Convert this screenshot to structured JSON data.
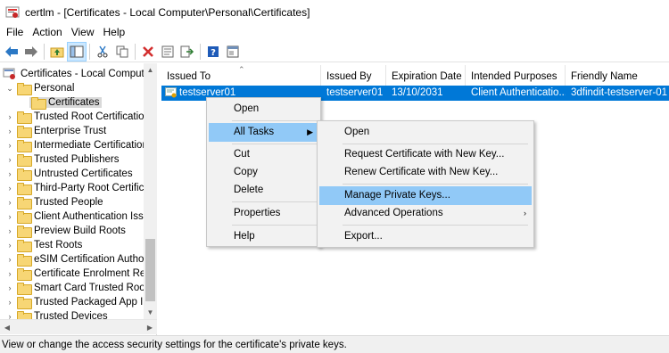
{
  "window": {
    "app_name": "certlm",
    "title": "certlm - [Certificates - Local Computer\\Personal\\Certificates]"
  },
  "menubar": [
    "File",
    "Action",
    "View",
    "Help"
  ],
  "toolbar": {
    "icons": [
      "back-arrow-icon",
      "forward-arrow-icon",
      "up-folder-icon",
      "show-hide-tree-icon",
      "cut-icon",
      "copy-icon",
      "delete-icon",
      "properties-icon",
      "export-icon",
      "help-icon",
      "console-icon"
    ]
  },
  "tree": {
    "root": "Certificates - Local Computer",
    "personal": "Personal",
    "certificates": "Certificates",
    "items": [
      "Trusted Root Certification",
      "Enterprise Trust",
      "Intermediate Certification",
      "Trusted Publishers",
      "Untrusted Certificates",
      "Third-Party Root Certificat",
      "Trusted People",
      "Client Authentication Issu",
      "Preview Build Roots",
      "Test Roots",
      "eSIM Certification Authori",
      "Certificate Enrolment Req",
      "Smart Card Trusted Roots",
      "Trusted Packaged App Inst",
      "Trusted Devices"
    ]
  },
  "list": {
    "columns": [
      "Issued To",
      "Issued By",
      "Expiration Date",
      "Intended Purposes",
      "Friendly Name"
    ],
    "rows": [
      {
        "issued_to": "testserver01",
        "issued_by": "testserver01",
        "expiration": "13/10/2031",
        "purposes": "Client Authenticatio...",
        "friendly_name": "3dfindit-testserver-01"
      }
    ]
  },
  "context_menu": {
    "items": [
      "Open",
      "All Tasks",
      "Cut",
      "Copy",
      "Delete",
      "Properties",
      "Help"
    ],
    "highlighted": "All Tasks"
  },
  "submenu": {
    "items": [
      "Open",
      "Request Certificate with New Key...",
      "Renew Certificate with New Key...",
      "Manage Private Keys...",
      "Advanced Operations",
      "Export..."
    ],
    "highlighted": "Manage Private Keys..."
  },
  "status": "View or change the access security settings for the certificate's private keys.",
  "colors": {
    "selection": "#0078d7",
    "menu_highlight": "#91c9f7",
    "folder": "#f7d675"
  }
}
